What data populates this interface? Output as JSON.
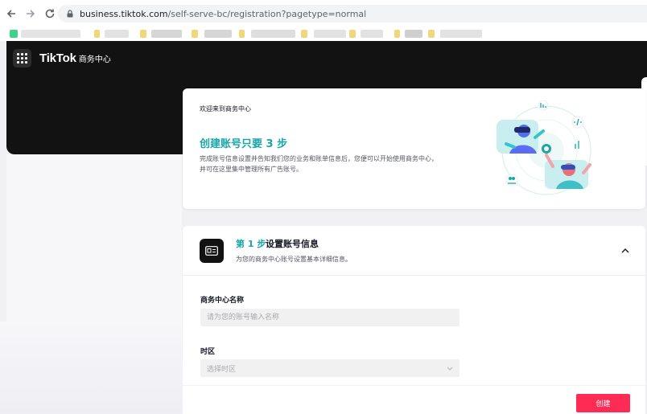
{
  "browser": {
    "url_host": "business.tiktok.com",
    "url_path": "/self-serve-bc/registration?pagetype=normal"
  },
  "header": {
    "brand": "TikTok",
    "brand_sub": "商务中心"
  },
  "welcome": {
    "label": "欢迎来到商务中心",
    "title": "创建账号只要 3 步",
    "desc_line1": "完成账号信息设置并告知我们您的业务和账单信息后，您便可以开始使用商务中心，",
    "desc_line2": "并可在这里集中管理所有广告账号。"
  },
  "step": {
    "number": "第 1 步",
    "title": "设置账号信息",
    "desc": "为您的商务中心账号设置基本详细信息。"
  },
  "form": {
    "name_label": "商务中心名称",
    "name_placeholder": "请为您的账号输入名称",
    "timezone_label": "时区",
    "timezone_placeholder": "选择时区"
  },
  "footer": {
    "create_label": "创建"
  },
  "colors": {
    "accent": "#1aa5a8",
    "primary_button": "#fe2c55",
    "dark_header": "#121212"
  },
  "icons": {
    "back": "arrow-left-icon",
    "forward": "arrow-right-icon",
    "reload": "reload-icon",
    "lock": "lock-icon",
    "apps": "grid-icon",
    "step": "id-card-icon",
    "collapse": "chevron-up-icon",
    "select": "chevron-down-icon"
  }
}
